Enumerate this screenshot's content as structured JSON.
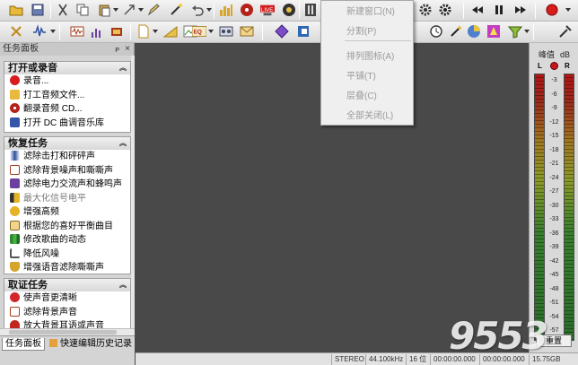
{
  "task_panel": {
    "title": "任务面板",
    "pin_glyph": "ᴘ",
    "close_glyph": "×",
    "sections": [
      {
        "title": "打开或录音",
        "items": [
          {
            "label": "录音...",
            "icon": "record-icon",
            "enabled": true
          },
          {
            "label": "打工音频文件...",
            "icon": "open-folder-icon",
            "enabled": true
          },
          {
            "label": "翻录音频 CD...",
            "icon": "cd-icon",
            "enabled": true
          },
          {
            "label": "打开 DC 曲调音乐库",
            "icon": "music-library-icon",
            "enabled": true
          }
        ]
      },
      {
        "title": "恢复任务",
        "items": [
          {
            "label": "滤除击打和砰砰声",
            "icon": "click-pop-icon",
            "enabled": true
          },
          {
            "label": "滤除背景噪声和嘶嘶声",
            "icon": "noise-icon",
            "enabled": true
          },
          {
            "label": "滤除电力交流声和蜂鸣声",
            "icon": "hum-icon",
            "enabled": true
          },
          {
            "label": "最大化信号电平",
            "icon": "maximize-level-icon",
            "enabled": false
          },
          {
            "label": "增强高频",
            "icon": "high-frequency-icon",
            "enabled": true
          },
          {
            "label": "根据您的喜好平衡曲目",
            "icon": "equalize-icon",
            "enabled": true
          },
          {
            "label": "修改歌曲的动态",
            "icon": "dynamics-icon",
            "enabled": true
          },
          {
            "label": "降低风噪",
            "icon": "wind-noise-icon",
            "enabled": true
          },
          {
            "label": "增强语音滤除嘶嘶声",
            "icon": "voice-icon",
            "enabled": true
          }
        ]
      },
      {
        "title": "取证任务",
        "items": [
          {
            "label": "使声音更清晰",
            "icon": "lips-icon",
            "enabled": true
          },
          {
            "label": "滤除背景声音",
            "icon": "filter-background-icon",
            "enabled": true
          },
          {
            "label": "放大背景耳语或声音",
            "icon": "amplify-whisper-icon",
            "enabled": true
          }
        ]
      }
    ],
    "tabs": [
      "任务面板",
      "快速编辑历史记录"
    ],
    "collapse_glyph": "︽"
  },
  "window_menu": {
    "items": [
      {
        "label": "新建窗口(N)",
        "enabled": false
      },
      {
        "label": "分割(P)",
        "enabled": false
      },
      {
        "label": "排列图标(A)",
        "enabled": false
      },
      {
        "label": "平铺(T)",
        "enabled": false
      },
      {
        "label": "层叠(C)",
        "enabled": false
      },
      {
        "label": "全部关闭(L)",
        "enabled": false
      }
    ]
  },
  "level_meter": {
    "title": "峰值",
    "unit": "dB",
    "left_label": "L",
    "right_label": "R",
    "reset_label": "重置",
    "scale_marks": [
      "-3",
      "-6",
      "-9",
      "-12",
      "-15",
      "-18",
      "-21",
      "-24",
      "-27",
      "-30",
      "-33",
      "-36",
      "-39",
      "-42",
      "-45",
      "-48",
      "-51",
      "-54",
      "-57"
    ]
  },
  "status_bar": {
    "channels": "STEREO",
    "sample_rate": "44.100kHz",
    "bit_depth": "16 位",
    "start_time": "00:00:00.000",
    "end_time": "00:00:00.000",
    "duration": "00:00:00.000",
    "disk_free": "15.75GB"
  },
  "watermark": "9553",
  "colors": {
    "workspace": "#494949",
    "panel": "#d4d4d4",
    "record": "#c8161c",
    "menu_disabled_text": "#9a9a9a"
  }
}
